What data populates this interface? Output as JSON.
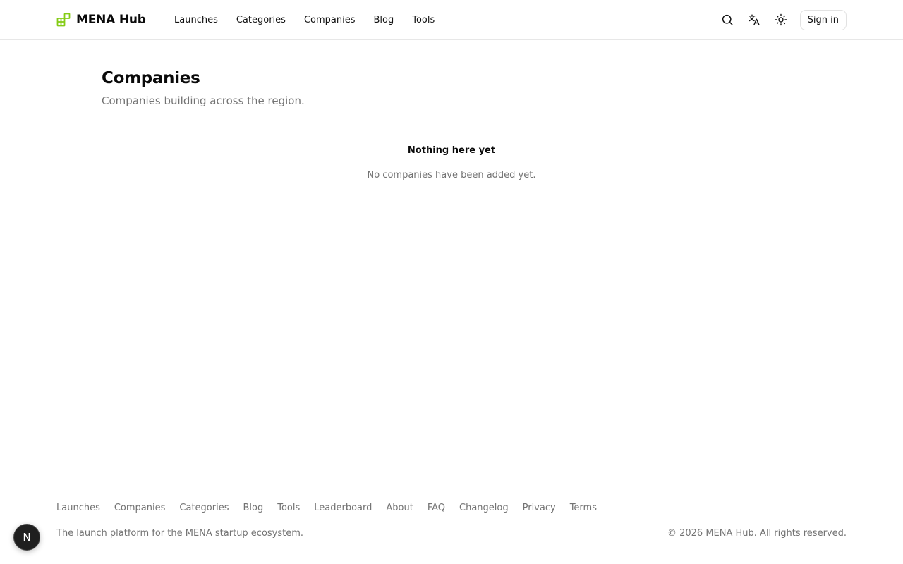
{
  "header": {
    "brand_name": "MENA Hub",
    "nav": [
      {
        "label": "Launches"
      },
      {
        "label": "Categories"
      },
      {
        "label": "Companies"
      },
      {
        "label": "Blog"
      },
      {
        "label": "Tools"
      }
    ],
    "icons": [
      "search-icon",
      "translate-icon",
      "sun-icon"
    ],
    "sign_in_label": "Sign in"
  },
  "main": {
    "title": "Companies",
    "subtitle": "Companies building across the region.",
    "empty_title": "Nothing here yet",
    "empty_text": "No companies have been added yet."
  },
  "footer": {
    "links": [
      {
        "label": "Launches"
      },
      {
        "label": "Companies"
      },
      {
        "label": "Categories"
      },
      {
        "label": "Blog"
      },
      {
        "label": "Tools"
      },
      {
        "label": "Leaderboard"
      },
      {
        "label": "About"
      },
      {
        "label": "FAQ"
      },
      {
        "label": "Changelog"
      },
      {
        "label": "Privacy"
      },
      {
        "label": "Terms"
      }
    ],
    "tagline": "The launch platform for the MENA startup ecosystem.",
    "copyright": "© 2026 MENA Hub. All rights reserved."
  },
  "devtools_badge": "N",
  "colors": {
    "accent": "#84cc16",
    "muted_text": "#737373",
    "border": "#e7e7e7"
  }
}
